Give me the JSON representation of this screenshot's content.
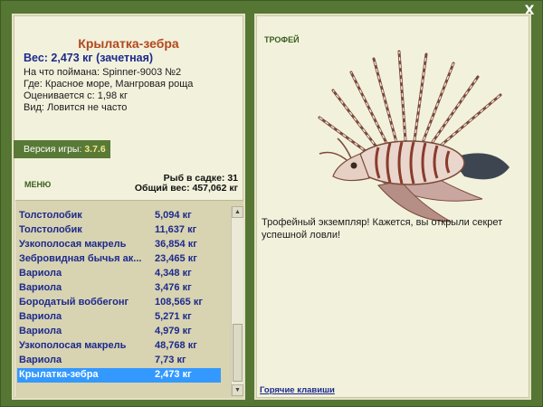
{
  "window": {
    "close_label": "X"
  },
  "fish": {
    "title": "Крылатка-зебра",
    "weight_line": "Вес: 2,473 кг (зачетная)",
    "caught_on": "На что поймана: Spinner-9003 №2",
    "location": "Где: Красное море, Мангровая роща",
    "valued": "Оценивается с: 1,98 кг",
    "kind": "Вид: Ловится не часто"
  },
  "version": {
    "label": "Версия игры:",
    "value": "3.7.6"
  },
  "menu": {
    "label": "МЕНЮ"
  },
  "summary": {
    "count": "Рыб в садке: 31",
    "total": "Общий вес: 457,062 кг"
  },
  "catch_list": [
    {
      "name": "Толстолобик",
      "weight": "5,094 кг"
    },
    {
      "name": "Толстолобик",
      "weight": "11,637 кг"
    },
    {
      "name": "Узкополосая макрель",
      "weight": "36,854 кг"
    },
    {
      "name": "Зебровидная бычья ак...",
      "weight": "23,465 кг"
    },
    {
      "name": "Вариола",
      "weight": "4,348 кг"
    },
    {
      "name": "Вариола",
      "weight": "3,476 кг"
    },
    {
      "name": "Бородатый воббегонг",
      "weight": "108,565 кг"
    },
    {
      "name": "Вариола",
      "weight": "5,271 кг"
    },
    {
      "name": "Вариола",
      "weight": "4,979 кг"
    },
    {
      "name": "Узкополосая макрель",
      "weight": "48,768 кг"
    },
    {
      "name": "Вариола",
      "weight": "7,73 кг"
    },
    {
      "name": "Крылатка-зебра",
      "weight": "2,473 кг"
    }
  ],
  "trophy": {
    "label": "ТРОФЕЙ",
    "text": "Трофейный экземпляр! Кажется, вы открыли секрет успешной ловли!"
  },
  "hotkeys": {
    "label": "Горячие клавиши"
  },
  "colors": {
    "frame": "#567634",
    "panel": "#f2f1dc",
    "title": "#b2471d",
    "list_text": "#1c2a8c",
    "selection": "#3399ff"
  }
}
